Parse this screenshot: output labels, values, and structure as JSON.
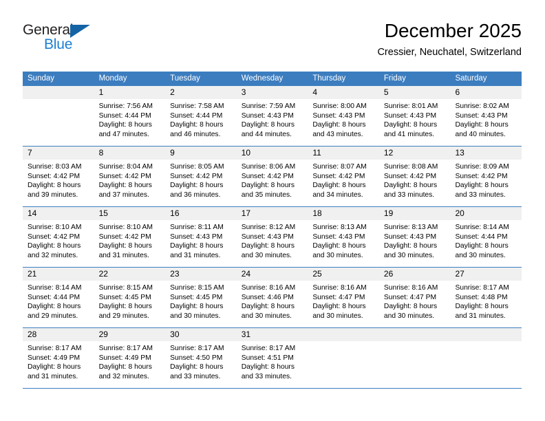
{
  "brand": {
    "name_part1": "General",
    "name_part2": "Blue",
    "triangle_color": "#1464a5",
    "blue_text_color": "#1b7fd4"
  },
  "header": {
    "title": "December 2025",
    "subtitle": "Cressier, Neuchatel, Switzerland"
  },
  "theme": {
    "header_bg": "#3c7dbf",
    "header_text": "#ffffff",
    "daynum_bg": "#f0f0f0",
    "cell_bg": "#ffffff",
    "row_border": "#3c7dbf"
  },
  "weekdays": [
    "Sunday",
    "Monday",
    "Tuesday",
    "Wednesday",
    "Thursday",
    "Friday",
    "Saturday"
  ],
  "weeks": [
    [
      {
        "day": "",
        "lines": []
      },
      {
        "day": "1",
        "lines": [
          "Sunrise: 7:56 AM",
          "Sunset: 4:44 PM",
          "Daylight: 8 hours",
          "and 47 minutes."
        ]
      },
      {
        "day": "2",
        "lines": [
          "Sunrise: 7:58 AM",
          "Sunset: 4:44 PM",
          "Daylight: 8 hours",
          "and 46 minutes."
        ]
      },
      {
        "day": "3",
        "lines": [
          "Sunrise: 7:59 AM",
          "Sunset: 4:43 PM",
          "Daylight: 8 hours",
          "and 44 minutes."
        ]
      },
      {
        "day": "4",
        "lines": [
          "Sunrise: 8:00 AM",
          "Sunset: 4:43 PM",
          "Daylight: 8 hours",
          "and 43 minutes."
        ]
      },
      {
        "day": "5",
        "lines": [
          "Sunrise: 8:01 AM",
          "Sunset: 4:43 PM",
          "Daylight: 8 hours",
          "and 41 minutes."
        ]
      },
      {
        "day": "6",
        "lines": [
          "Sunrise: 8:02 AM",
          "Sunset: 4:43 PM",
          "Daylight: 8 hours",
          "and 40 minutes."
        ]
      }
    ],
    [
      {
        "day": "7",
        "lines": [
          "Sunrise: 8:03 AM",
          "Sunset: 4:42 PM",
          "Daylight: 8 hours",
          "and 39 minutes."
        ]
      },
      {
        "day": "8",
        "lines": [
          "Sunrise: 8:04 AM",
          "Sunset: 4:42 PM",
          "Daylight: 8 hours",
          "and 37 minutes."
        ]
      },
      {
        "day": "9",
        "lines": [
          "Sunrise: 8:05 AM",
          "Sunset: 4:42 PM",
          "Daylight: 8 hours",
          "and 36 minutes."
        ]
      },
      {
        "day": "10",
        "lines": [
          "Sunrise: 8:06 AM",
          "Sunset: 4:42 PM",
          "Daylight: 8 hours",
          "and 35 minutes."
        ]
      },
      {
        "day": "11",
        "lines": [
          "Sunrise: 8:07 AM",
          "Sunset: 4:42 PM",
          "Daylight: 8 hours",
          "and 34 minutes."
        ]
      },
      {
        "day": "12",
        "lines": [
          "Sunrise: 8:08 AM",
          "Sunset: 4:42 PM",
          "Daylight: 8 hours",
          "and 33 minutes."
        ]
      },
      {
        "day": "13",
        "lines": [
          "Sunrise: 8:09 AM",
          "Sunset: 4:42 PM",
          "Daylight: 8 hours",
          "and 33 minutes."
        ]
      }
    ],
    [
      {
        "day": "14",
        "lines": [
          "Sunrise: 8:10 AM",
          "Sunset: 4:42 PM",
          "Daylight: 8 hours",
          "and 32 minutes."
        ]
      },
      {
        "day": "15",
        "lines": [
          "Sunrise: 8:10 AM",
          "Sunset: 4:42 PM",
          "Daylight: 8 hours",
          "and 31 minutes."
        ]
      },
      {
        "day": "16",
        "lines": [
          "Sunrise: 8:11 AM",
          "Sunset: 4:43 PM",
          "Daylight: 8 hours",
          "and 31 minutes."
        ]
      },
      {
        "day": "17",
        "lines": [
          "Sunrise: 8:12 AM",
          "Sunset: 4:43 PM",
          "Daylight: 8 hours",
          "and 30 minutes."
        ]
      },
      {
        "day": "18",
        "lines": [
          "Sunrise: 8:13 AM",
          "Sunset: 4:43 PM",
          "Daylight: 8 hours",
          "and 30 minutes."
        ]
      },
      {
        "day": "19",
        "lines": [
          "Sunrise: 8:13 AM",
          "Sunset: 4:43 PM",
          "Daylight: 8 hours",
          "and 30 minutes."
        ]
      },
      {
        "day": "20",
        "lines": [
          "Sunrise: 8:14 AM",
          "Sunset: 4:44 PM",
          "Daylight: 8 hours",
          "and 30 minutes."
        ]
      }
    ],
    [
      {
        "day": "21",
        "lines": [
          "Sunrise: 8:14 AM",
          "Sunset: 4:44 PM",
          "Daylight: 8 hours",
          "and 29 minutes."
        ]
      },
      {
        "day": "22",
        "lines": [
          "Sunrise: 8:15 AM",
          "Sunset: 4:45 PM",
          "Daylight: 8 hours",
          "and 29 minutes."
        ]
      },
      {
        "day": "23",
        "lines": [
          "Sunrise: 8:15 AM",
          "Sunset: 4:45 PM",
          "Daylight: 8 hours",
          "and 30 minutes."
        ]
      },
      {
        "day": "24",
        "lines": [
          "Sunrise: 8:16 AM",
          "Sunset: 4:46 PM",
          "Daylight: 8 hours",
          "and 30 minutes."
        ]
      },
      {
        "day": "25",
        "lines": [
          "Sunrise: 8:16 AM",
          "Sunset: 4:47 PM",
          "Daylight: 8 hours",
          "and 30 minutes."
        ]
      },
      {
        "day": "26",
        "lines": [
          "Sunrise: 8:16 AM",
          "Sunset: 4:47 PM",
          "Daylight: 8 hours",
          "and 30 minutes."
        ]
      },
      {
        "day": "27",
        "lines": [
          "Sunrise: 8:17 AM",
          "Sunset: 4:48 PM",
          "Daylight: 8 hours",
          "and 31 minutes."
        ]
      }
    ],
    [
      {
        "day": "28",
        "lines": [
          "Sunrise: 8:17 AM",
          "Sunset: 4:49 PM",
          "Daylight: 8 hours",
          "and 31 minutes."
        ]
      },
      {
        "day": "29",
        "lines": [
          "Sunrise: 8:17 AM",
          "Sunset: 4:49 PM",
          "Daylight: 8 hours",
          "and 32 minutes."
        ]
      },
      {
        "day": "30",
        "lines": [
          "Sunrise: 8:17 AM",
          "Sunset: 4:50 PM",
          "Daylight: 8 hours",
          "and 33 minutes."
        ]
      },
      {
        "day": "31",
        "lines": [
          "Sunrise: 8:17 AM",
          "Sunset: 4:51 PM",
          "Daylight: 8 hours",
          "and 33 minutes."
        ]
      },
      {
        "day": "",
        "lines": []
      },
      {
        "day": "",
        "lines": []
      },
      {
        "day": "",
        "lines": []
      }
    ]
  ]
}
